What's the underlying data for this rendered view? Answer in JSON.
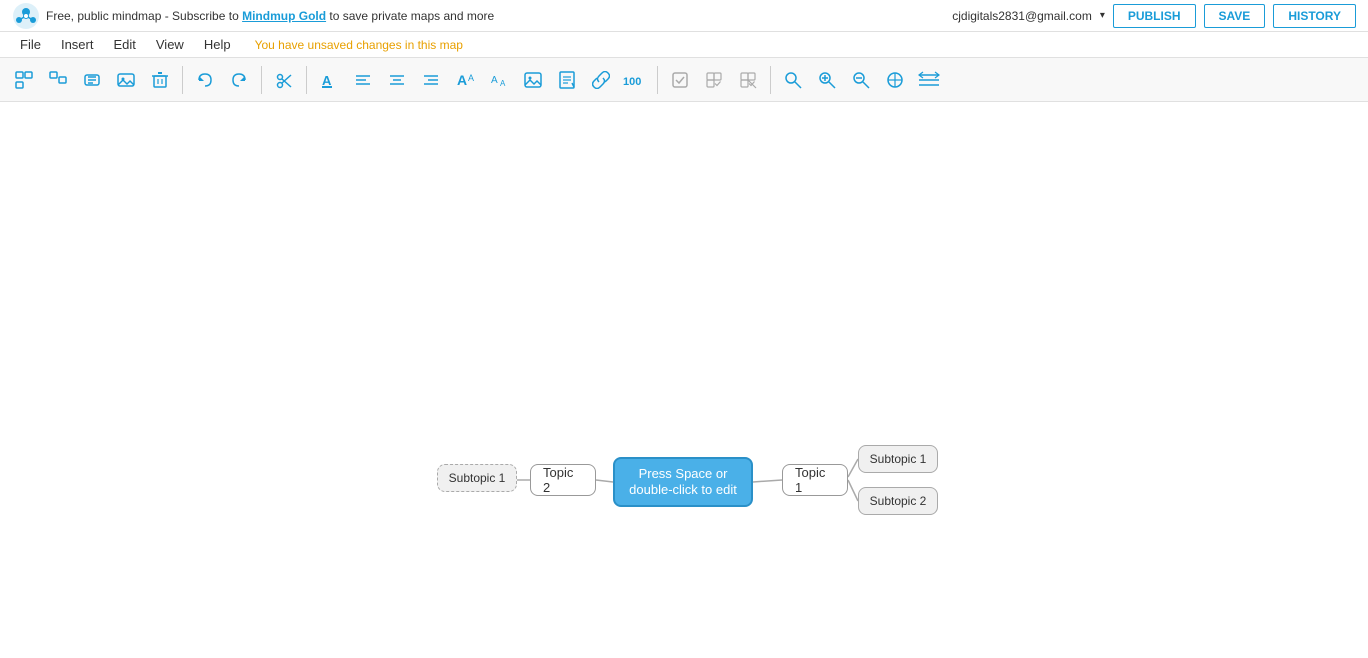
{
  "topbar": {
    "announcement": "Free, public mindmap - Subscribe to ",
    "brand": "Mindmup Gold",
    "announcement_suffix": " to save private maps and more",
    "user_email": "cjdigitals2831@gmail.com",
    "publish_label": "PUBLISH",
    "save_label": "SAVE",
    "history_label": "HISTORY"
  },
  "menubar": {
    "file": "File",
    "insert": "Insert",
    "edit": "Edit",
    "view": "View",
    "help": "Help",
    "unsaved": "You have unsaved changes in this map"
  },
  "nodes": {
    "center": "Press Space or double-click to edit",
    "topic2": "Topic 2",
    "topic1": "Topic 1",
    "subtopic1": "Subtopic 1",
    "subtopic2": "Subtopic 2",
    "subtopic2_1": "Subtopic 1"
  },
  "toolbar": {
    "icons": [
      "⊞",
      "❐",
      "⊟",
      "🖼",
      "🗑",
      "↩",
      "↪",
      "✂",
      "A",
      "A",
      "A",
      "A",
      "🖼",
      "⬡",
      "🔗",
      "100",
      "✓",
      "✓",
      "✓",
      "🔍",
      "🔍+",
      "🔍-",
      "⊕",
      "≡"
    ]
  }
}
